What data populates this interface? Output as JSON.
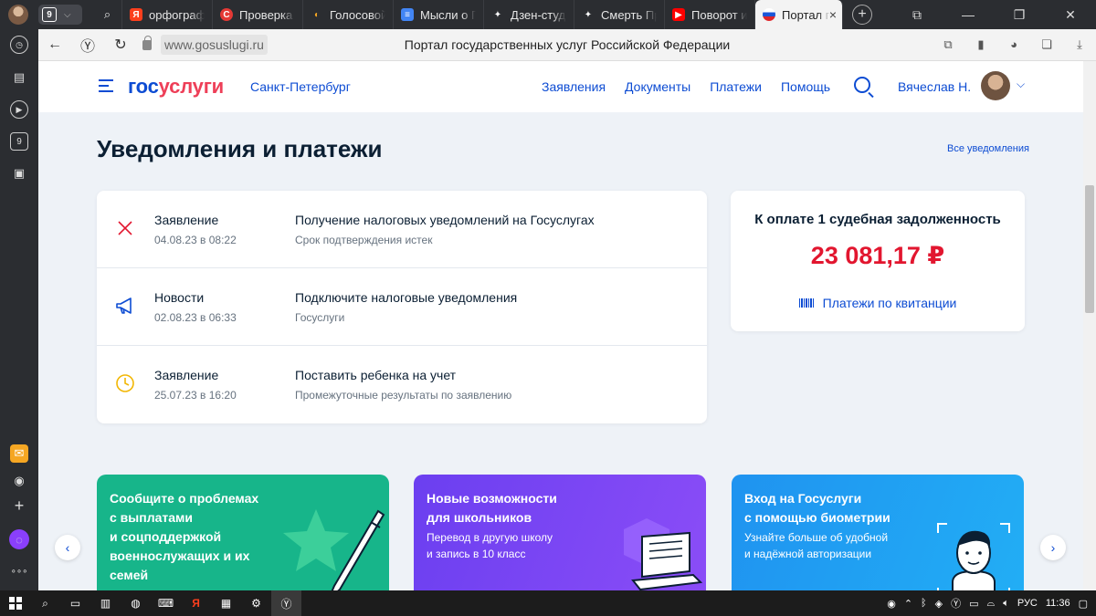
{
  "browser": {
    "tab_counter": "9",
    "tabs": [
      {
        "label": "",
        "icon": "search-icon",
        "color": ""
      },
      {
        "label": "орфографи",
        "icon": "yandex-icon",
        "color": "#fc3f1d"
      },
      {
        "label": "Проверка с",
        "icon": "red-circle-icon",
        "color": "#e53935"
      },
      {
        "label": "Голосовой",
        "icon": "voice-icon",
        "color": "#f5a623"
      },
      {
        "label": "Мысли о Пу",
        "icon": "docs-icon",
        "color": "#4285f4"
      },
      {
        "label": "Дзен-студи",
        "icon": "dzen-icon",
        "color": "#000000"
      },
      {
        "label": "Смерть Прі",
        "icon": "dzen-icon",
        "color": "#000000"
      },
      {
        "label": "Поворот ис",
        "icon": "youtube-icon",
        "color": "#ff0000"
      },
      {
        "label": "Портал г",
        "icon": "flag-icon",
        "color": "#ffffff"
      }
    ],
    "url": "www.gosuslugi.ru",
    "page_title": "Портал государственных услуг Российской Федерации",
    "sidebar_counter": "9"
  },
  "header": {
    "logo_part1": "гос",
    "logo_part2": "услуги",
    "city": "Санкт-Петербург",
    "nav": [
      "Заявления",
      "Документы",
      "Платежи",
      "Помощь"
    ],
    "user_name": "Вячеслав Н."
  },
  "main": {
    "title": "Уведомления и платежи",
    "all_link": "Все уведомления",
    "notifications": [
      {
        "kind": "Заявление",
        "date": "04.08.23 в 08:22",
        "title": "Получение налоговых уведомлений на Госуслугах",
        "sub": "Срок подтверждения истек",
        "icon": "cross-icon"
      },
      {
        "kind": "Новости",
        "date": "02.08.23 в 06:33",
        "title": "Подключите налоговые уведомления",
        "sub": "Госуслуги",
        "icon": "megaphone-icon"
      },
      {
        "kind": "Заявление",
        "date": "25.07.23 в 16:20",
        "title": "Поставить ребенка на учет",
        "sub": "Промежуточные результаты по заявлению",
        "icon": "clock-icon"
      }
    ],
    "payment": {
      "title": "К оплате 1 судебная задолженность",
      "amount": "23 081,17 ₽",
      "link": "Платежи по квитанции"
    },
    "promos": [
      {
        "title_lines": [
          "Сообщите о проблемах",
          "с выплатами",
          "и соцподдержкой",
          "военнослужащих и их",
          "семей"
        ],
        "sub_lines": []
      },
      {
        "title_lines": [
          "Новые возможности",
          "для школьников"
        ],
        "sub_lines": [
          "Перевод в другую школу",
          "и запись в 10 класс"
        ]
      },
      {
        "title_lines": [
          "Вход на Госуслуги",
          "с помощью биометрии"
        ],
        "sub_lines": [
          "Узнайте больше об удобной",
          "и надёжной авторизации"
        ]
      }
    ]
  },
  "taskbar": {
    "lang": "РУС",
    "time": "11:36"
  },
  "colors": {
    "brand_blue": "#0d4cd3",
    "brand_red": "#ee3f58",
    "amount_red": "#e2162f",
    "cross_red": "#e2162f",
    "clock_yellow": "#f2b705"
  }
}
